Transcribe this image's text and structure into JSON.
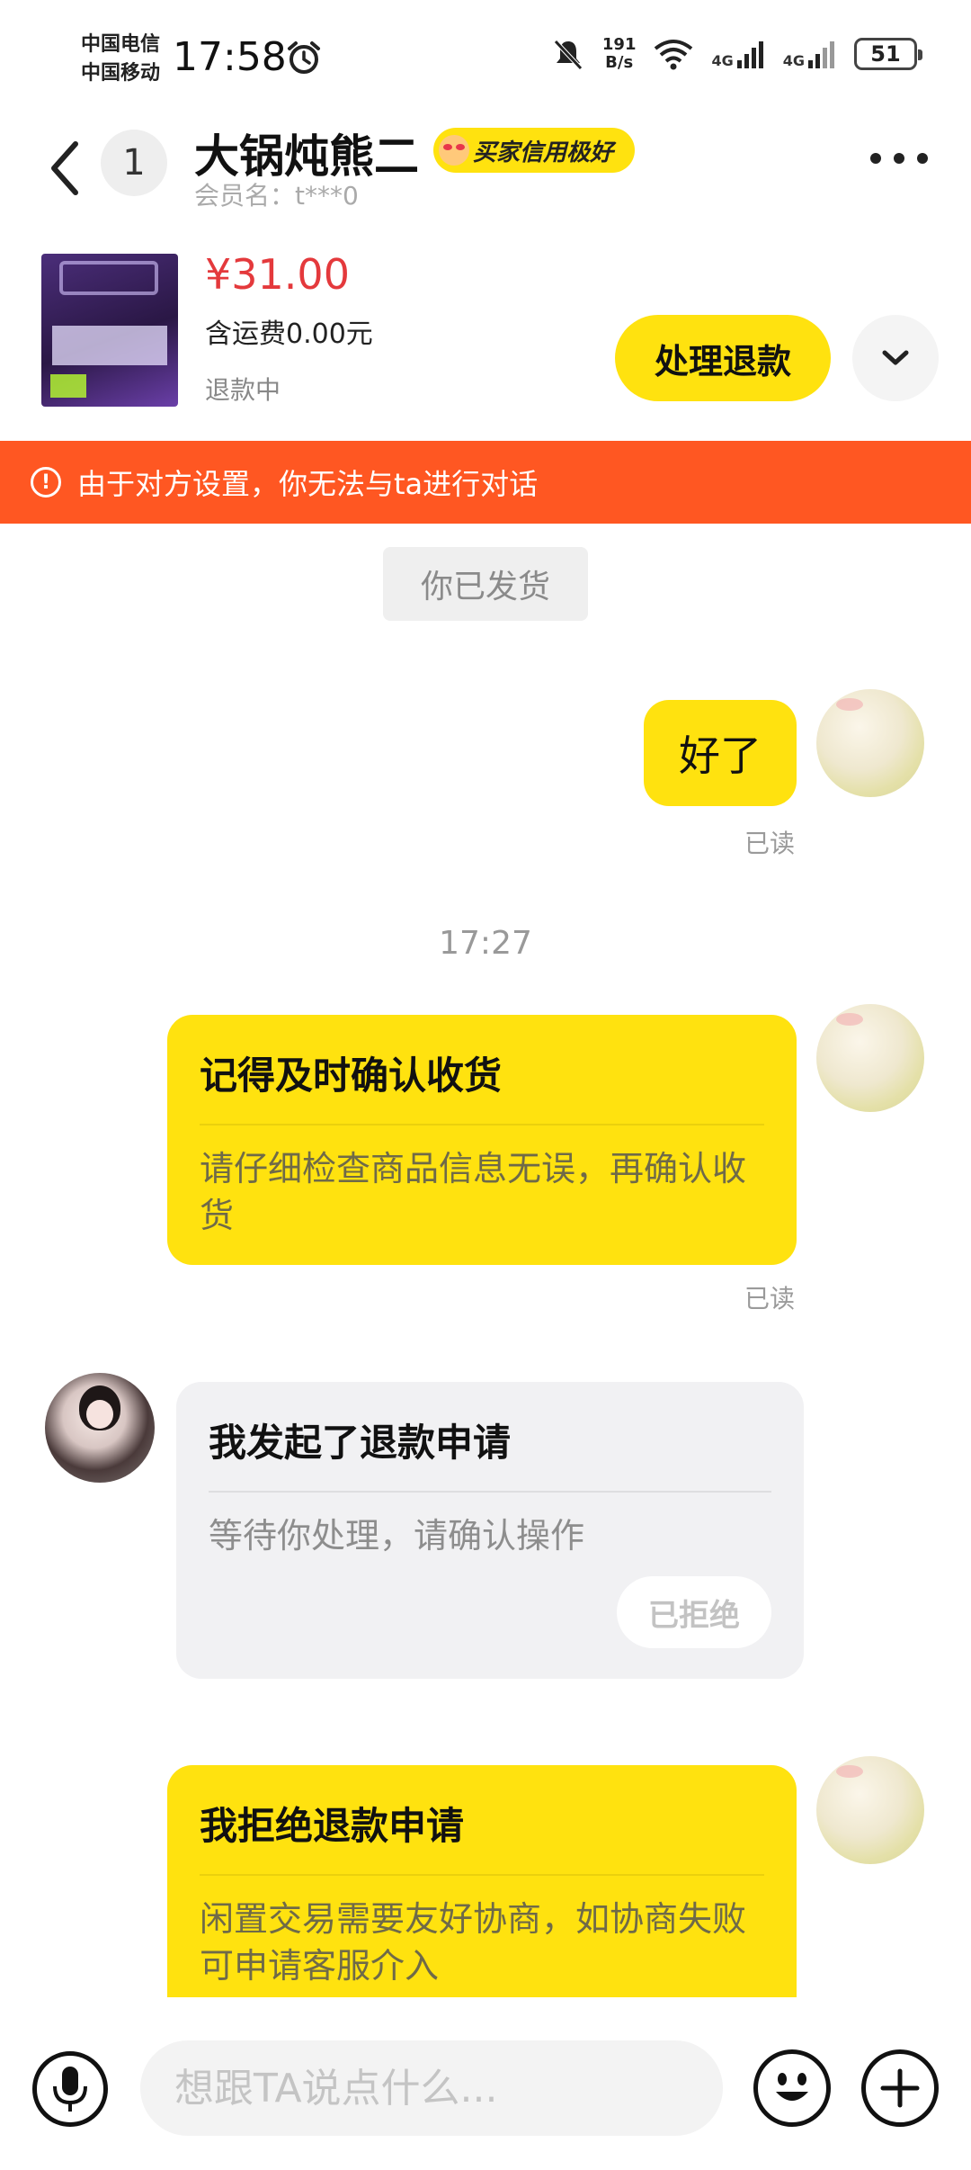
{
  "status_bar": {
    "carrier_1": "中国电信",
    "carrier_2": "中国移动",
    "time": "17:58",
    "speed_value": "191",
    "speed_unit": "B/s",
    "network_1": "4G",
    "network_2": "4G",
    "battery": "51"
  },
  "header": {
    "unread_count": "1",
    "nickname": "大锅炖熊二",
    "credit_badge": "买家信用极好",
    "member_name": "会员名：t***0"
  },
  "product": {
    "price": "¥31.00",
    "shipping": "含运费0.00元",
    "status": "退款中",
    "refund_button": "处理退款"
  },
  "warning": {
    "text": "由于对方设置，你无法与ta进行对话"
  },
  "chat": {
    "system_notice": "你已发货",
    "msg_text": "好了",
    "read_1": "已读",
    "timestamp": "17:27",
    "confirm_card": {
      "title": "记得及时确认收货",
      "body": "请仔细检查商品信息无误，再确认收货"
    },
    "read_2": "已读",
    "refund_request_card": {
      "title": "我发起了退款申请",
      "body": "等待你处理，请确认操作",
      "status": "已拒绝"
    },
    "reject_card": {
      "title": "我拒绝退款申请",
      "body": "闲置交易需要友好协商，如协商失败可申请客服介入"
    }
  },
  "input": {
    "placeholder": "想跟TA说点什么..."
  },
  "colors": {
    "accent": "#ffe20f",
    "price": "#e4393c",
    "warning": "#ff5722"
  },
  "icons": [
    "alarm-icon",
    "mute-icon",
    "wifi-icon",
    "signal-icon",
    "battery-icon",
    "back-icon",
    "more-icon",
    "chevron-down-icon",
    "warning-icon",
    "mic-icon",
    "emoji-icon",
    "plus-icon"
  ]
}
